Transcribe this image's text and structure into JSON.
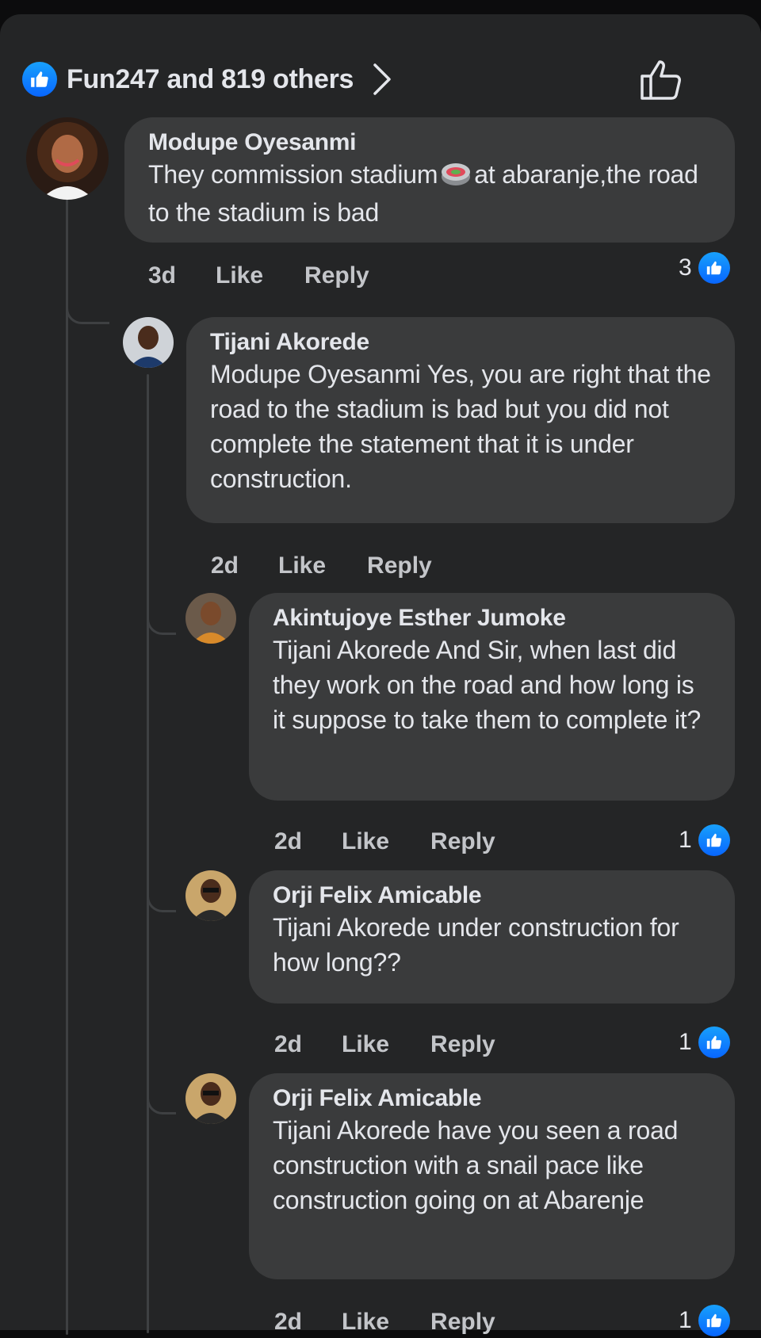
{
  "header": {
    "reaction_summary": "Fun247 and 819 others",
    "icons": [
      "like-icon",
      "chevron-right-icon",
      "thumbs-up-outline-icon"
    ]
  },
  "comments": [
    {
      "author": "Modupe Oyesanmi",
      "text_before": "They commission stadium",
      "emoji": "stadium-emoji",
      "text_after": "at abaranje,the road to the stadium is bad",
      "time": "3d",
      "like": "Like",
      "reply": "Reply",
      "reactions": "3"
    },
    {
      "author": "Tijani Akorede",
      "text": "Modupe Oyesanmi  Yes, you are right that the road to the stadium is bad but you did not complete the statement that it is under construction.",
      "time": "2d",
      "like": "Like",
      "reply": "Reply",
      "reactions": ""
    },
    {
      "author": "Akintujoye Esther Jumoke",
      "text": "Tijani Akorede  And Sir, when last did they work on the road and how long is it suppose to take them to complete it?",
      "time": "2d",
      "like": "Like",
      "reply": "Reply",
      "reactions": "1"
    },
    {
      "author": "Orji Felix Amicable",
      "text": "Tijani Akorede under construction for how long??",
      "time": "2d",
      "like": "Like",
      "reply": "Reply",
      "reactions": "1"
    },
    {
      "author": "Orji Felix Amicable",
      "text": "Tijani Akorede have you seen a road construction with a snail pace like construction going on at Abarenje",
      "time": "2d",
      "like": "Like",
      "reply": "Reply",
      "reactions": "1"
    }
  ],
  "colors": {
    "background": "#242526",
    "bubble": "#3a3b3c",
    "accent": "#0866ff",
    "text": "#e4e6eb",
    "muted": "#c3c5c9"
  }
}
